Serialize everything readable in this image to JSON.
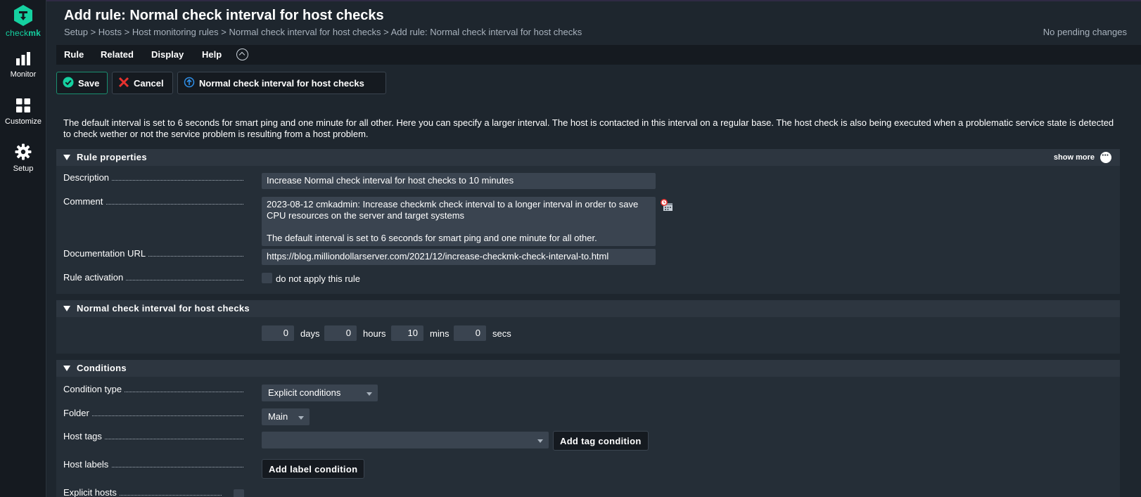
{
  "app": {
    "logo_text_a": "check",
    "logo_text_b": "mk"
  },
  "sidebar": {
    "items": [
      {
        "label": "Monitor",
        "icon": "bar-chart-icon"
      },
      {
        "label": "Customize",
        "icon": "grid-icon"
      },
      {
        "label": "Setup",
        "icon": "gear-icon"
      }
    ]
  },
  "header": {
    "title": "Add rule: Normal check interval for host checks",
    "breadcrumb": "Setup > Hosts > Host monitoring rules > Normal check interval for host checks > Add rule: Normal check interval for host checks",
    "pending": "No pending changes"
  },
  "menu": {
    "rule": "Rule",
    "related": "Related",
    "display": "Display",
    "help": "Help"
  },
  "toolbar": {
    "save": "Save",
    "cancel": "Cancel",
    "ruleset": "Normal check interval for host checks"
  },
  "intro": "The default interval is set to 6 seconds for smart ping and one minute for all other. Here you can specify a larger interval. The host is contacted in this interval on a regular base. The host check is also being executed when a problematic service state is detected to check wether or not the service problem is resulting from a host problem.",
  "rule_properties": {
    "heading": "Rule properties",
    "show_more": "show more",
    "description_label": "Description",
    "description_value": "Increase Normal check interval for host checks to 10 minutes",
    "comment_label": "Comment",
    "comment_value": "2023-08-12 cmkadmin: Increase checkmk check interval to a longer interval in order to save CPU resources on the server and target systems\n\nThe default interval is set to 6 seconds for smart ping and one minute for all other.",
    "doc_url_label": "Documentation URL",
    "doc_url_value": "https://blog.milliondollarserver.com/2021/12/increase-checkmk-check-interval-to.html",
    "activation_label": "Rule activation",
    "activation_checkbox": "do not apply this rule"
  },
  "value_section": {
    "heading": "Normal check interval for host checks",
    "days": "0",
    "days_unit": "days",
    "hours": "0",
    "hours_unit": "hours",
    "mins": "10",
    "mins_unit": "mins",
    "secs": "0",
    "secs_unit": "secs"
  },
  "conditions": {
    "heading": "Conditions",
    "condition_type_label": "Condition type",
    "condition_type_value": "Explicit conditions",
    "folder_label": "Folder",
    "folder_value": "Main",
    "host_tags_label": "Host tags",
    "add_tag_condition": "Add tag condition",
    "host_labels_label": "Host labels",
    "add_label_condition": "Add label condition",
    "explicit_hosts_label": "Explicit hosts"
  },
  "colors": {
    "accent": "#15d1a0",
    "cancel_red": "#e8322f",
    "info_blue": "#2f8fe8",
    "background": "#1e262e"
  }
}
